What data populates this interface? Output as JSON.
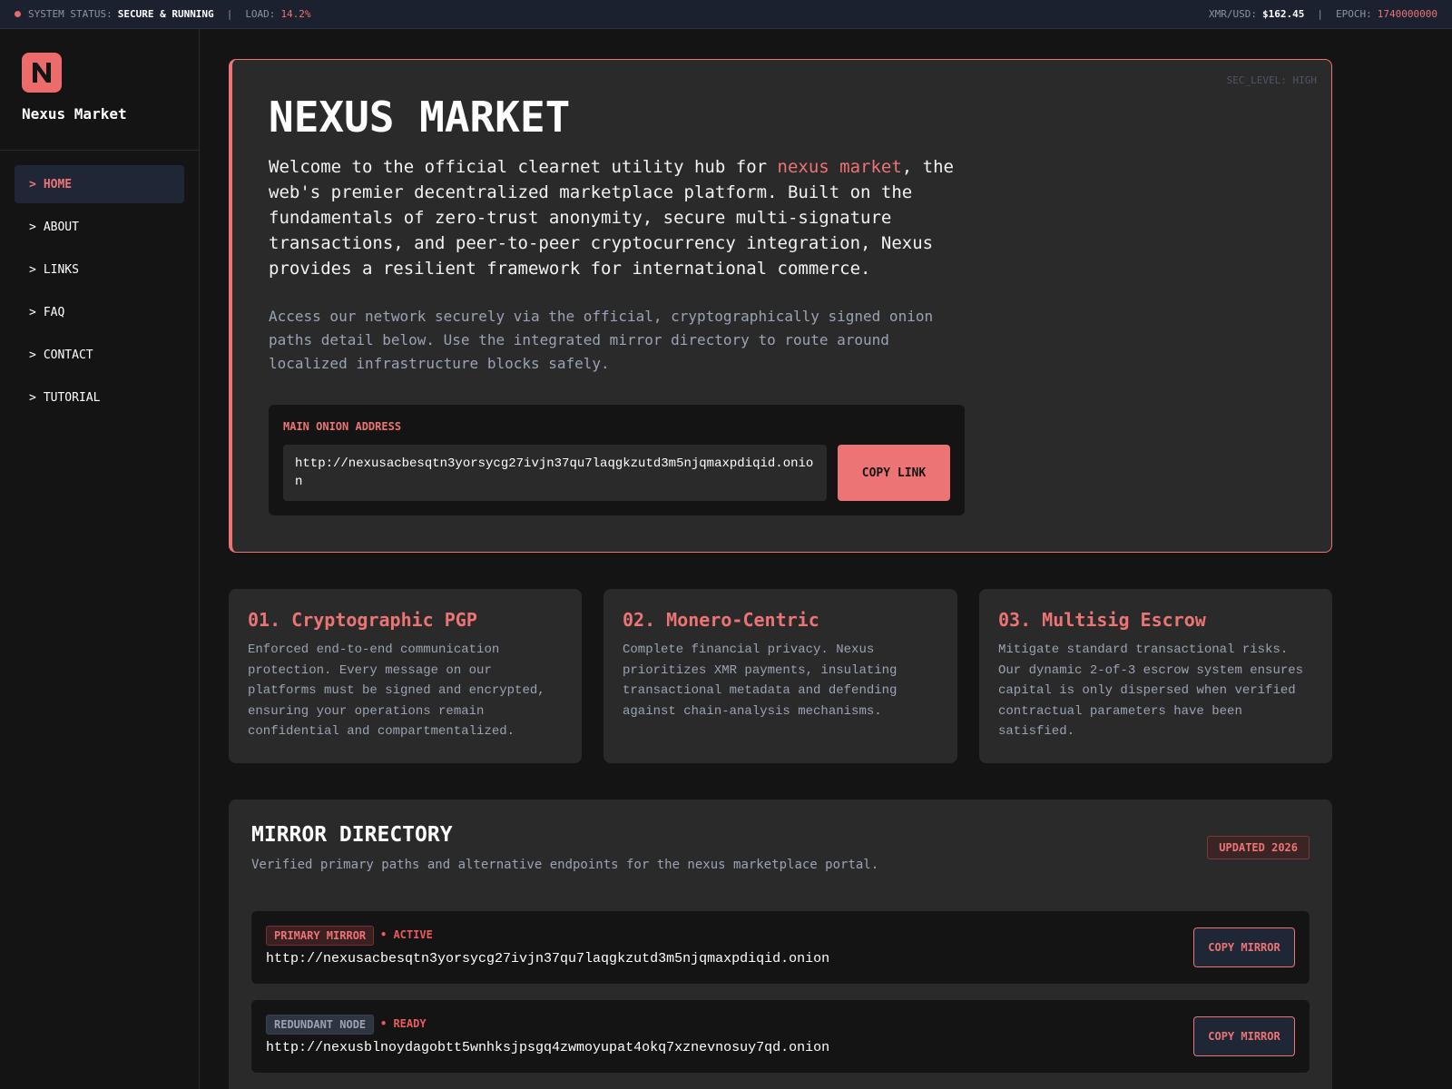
{
  "topbar": {
    "status_label": "SYSTEM STATUS:",
    "status_value": "SECURE & RUNNING",
    "sep": "|",
    "load_label": "LOAD:",
    "load_value": "14.2%",
    "price_label": "XMR/USD:",
    "price_value": "$162.45",
    "epoch_label": "EPOCH:",
    "epoch_value": "1740000000"
  },
  "sidebar": {
    "logo_letter": "N",
    "brand_name": "Nexus Market",
    "items": [
      {
        "caret": ">",
        "label": "HOME"
      },
      {
        "caret": ">",
        "label": "ABOUT"
      },
      {
        "caret": ">",
        "label": "LINKS"
      },
      {
        "caret": ">",
        "label": "FAQ"
      },
      {
        "caret": ">",
        "label": "CONTACT"
      },
      {
        "caret": ">",
        "label": "TUTORIAL"
      }
    ]
  },
  "hero": {
    "sec_level": "SEC_LEVEL: HIGH",
    "title": "NEXUS MARKET",
    "lead_before": "Welcome to the official clearnet utility hub for ",
    "lead_highlight": "nexus market",
    "lead_after": ", the web's premier decentralized marketplace platform. Built on the fundamentals of zero-trust anonymity, secure multi-signature transactions, and peer-to-peer cryptocurrency integration, Nexus provides a resilient framework for international commerce.",
    "sub": "Access our network securely via the official, cryptographically signed onion paths detail below. Use the integrated mirror directory to route around localized infrastructure blocks safely.",
    "address_label": "MAIN ONION ADDRESS",
    "address_value": "http://nexusacbesqtn3yorsycg27ivjn37qu7laqgkzutd3m5njqmaxpdiqid.onion",
    "copy_label": "COPY LINK"
  },
  "features": [
    {
      "title": "01. Cryptographic PGP",
      "body": "Enforced end-to-end communication protection. Every message on our platforms must be signed and encrypted, ensuring your operations remain confidential and compartmentalized."
    },
    {
      "title": "02. Monero-Centric",
      "body": "Complete financial privacy. Nexus prioritizes XMR payments, insulating transactional metadata and defending against chain-analysis mechanisms."
    },
    {
      "title": "03. Multisig Escrow",
      "body": "Mitigate standard transactional risks. Our dynamic 2-of-3 escrow system ensures capital is only dispersed when verified contractual parameters have been satisfied."
    }
  ],
  "mirrors": {
    "title": "MIRROR DIRECTORY",
    "subtitle": "Verified primary paths and alternative endpoints for the nexus marketplace portal.",
    "updated": "UPDATED 2026",
    "rows": [
      {
        "badge": "PRIMARY MIRROR",
        "status": "• ACTIVE",
        "url": "http://nexusacbesqtn3yorsycg27ivjn37qu7laqgkzutd3m5njqmaxpdiqid.onion",
        "button": "COPY MIRROR"
      },
      {
        "badge": "REDUNDANT NODE",
        "status": "• READY",
        "url": "http://nexusblnoydagobtt5wnhksjpsgq4zwmoyupat4okq7xznevnosuy7qd.onion",
        "button": "COPY MIRROR"
      }
    ]
  },
  "colors": {
    "accent": "#ec7474",
    "background": "#141414",
    "panel": "#2a2a2a",
    "topbar": "#1c2130",
    "muted_text": "#9aa3b5"
  }
}
